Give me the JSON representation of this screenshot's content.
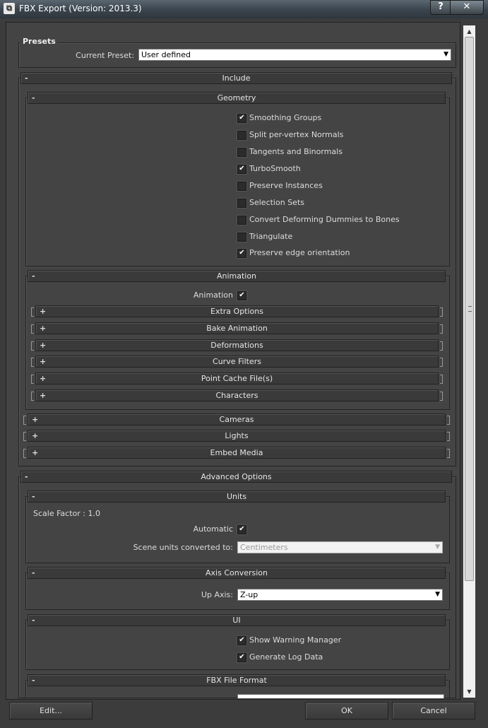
{
  "window": {
    "title": "FBX Export (Version: 2013.3)",
    "help_label": "?",
    "close_label": "✕",
    "app_icon": "max-logo-icon"
  },
  "presets": {
    "group_label": "Presets",
    "current_preset_label": "Current Preset:",
    "current_preset_value": "User defined"
  },
  "include": {
    "title": "Include",
    "geometry": {
      "title": "Geometry",
      "options": [
        {
          "label": "Smoothing Groups",
          "checked": true
        },
        {
          "label": "Split per-vertex Normals",
          "checked": false
        },
        {
          "label": "Tangents and Binormals",
          "checked": false
        },
        {
          "label": "TurboSmooth",
          "checked": true
        },
        {
          "label": "Preserve Instances",
          "checked": false
        },
        {
          "label": "Selection Sets",
          "checked": false
        },
        {
          "label": "Convert Deforming Dummies to Bones",
          "checked": false
        },
        {
          "label": "Triangulate",
          "checked": false
        },
        {
          "label": "Preserve edge orientation",
          "checked": true
        }
      ]
    },
    "animation": {
      "title": "Animation",
      "animation_label": "Animation",
      "animation_checked": true,
      "subrollouts": [
        "Extra Options",
        "Bake Animation",
        "Deformations",
        "Curve Filters",
        "Point Cache File(s)",
        "Characters"
      ]
    },
    "cameras_label": "Cameras",
    "lights_label": "Lights",
    "embed_media_label": "Embed Media"
  },
  "advanced": {
    "title": "Advanced Options",
    "units": {
      "title": "Units",
      "scale_factor_text": "Scale Factor : 1.0",
      "automatic_label": "Automatic",
      "automatic_checked": true,
      "scene_units_label": "Scene units converted to:",
      "scene_units_value": "Centimeters"
    },
    "axis": {
      "title": "Axis Conversion",
      "up_axis_label": "Up Axis:",
      "up_axis_value": "Z-up"
    },
    "ui": {
      "title": "UI",
      "options": [
        {
          "label": "Show Warning Manager",
          "checked": true
        },
        {
          "label": "Generate Log Data",
          "checked": true
        }
      ]
    },
    "fbx_file_format_title": "FBX File Format"
  },
  "rollout_symbols": {
    "expanded": "-",
    "collapsed": "+"
  },
  "check_mark": "✔",
  "dropdown_arrow": "▼",
  "buttons": {
    "edit": "Edit...",
    "ok": "OK",
    "cancel": "Cancel"
  },
  "scrollbar": {
    "up_arrow": "▲",
    "down_arrow": "▼"
  }
}
